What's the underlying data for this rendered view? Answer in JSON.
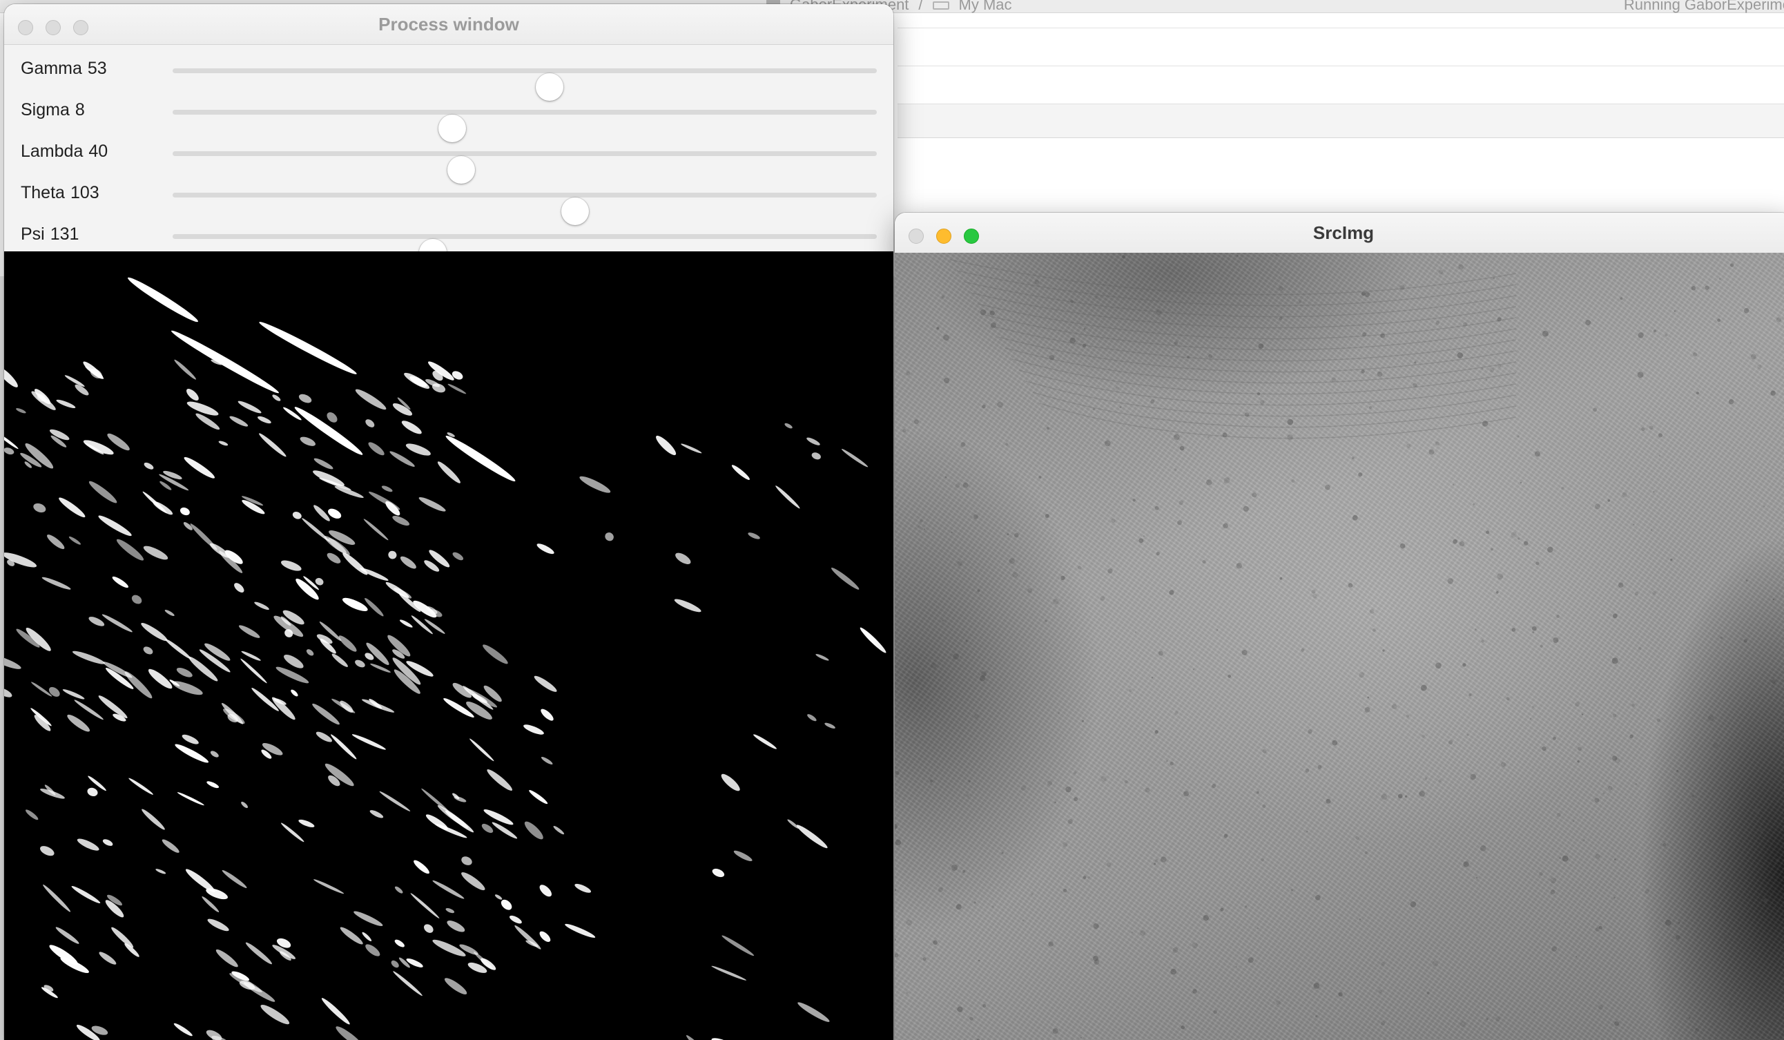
{
  "background_ide": {
    "breadcrumb": [
      "GaborExperiment",
      "My Mac"
    ],
    "status": "Running GaborExperime"
  },
  "process_window": {
    "title": "Process window",
    "sliders": [
      {
        "name": "Gamma",
        "value": "53",
        "level": 0.535
      },
      {
        "name": "Sigma",
        "value": "8",
        "level": 0.397
      },
      {
        "name": "Lambda",
        "value": "40",
        "level": 0.41
      },
      {
        "name": "Theta",
        "value": "103",
        "level": 0.572
      },
      {
        "name": "Psi",
        "value": "131",
        "level": 0.37
      }
    ]
  },
  "src_window": {
    "title": "SrcImg"
  },
  "colors": {
    "close": "#ff5f57",
    "minimize": "#febc2e",
    "maximize": "#28c840",
    "inactive_light": "#dcdcdc"
  }
}
